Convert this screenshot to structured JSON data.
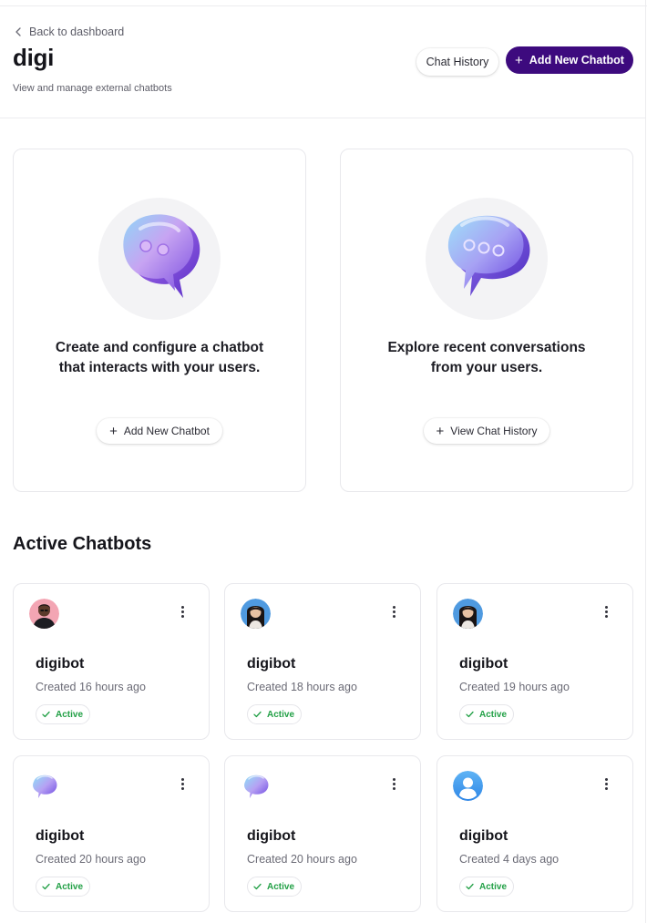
{
  "header": {
    "back_label": "Back to dashboard",
    "title": "digi",
    "subtitle": "View and manage external chatbots",
    "chat_history_label": "Chat History",
    "add_chatbot_label": "Add New Chatbot"
  },
  "features": [
    {
      "text": "Create and configure a chatbot that interacts with your users.",
      "button_label": "Add New Chatbot",
      "button_icon": "plus-icon",
      "illustration": "chat-bubble-two-dots"
    },
    {
      "text": "Explore recent conversations from your users.",
      "button_label": "View Chat History",
      "button_icon": "plus-icon",
      "illustration": "chat-bubble-three-dots"
    }
  ],
  "active_section": {
    "title": "Active Chatbots"
  },
  "bots": [
    {
      "name": "digibot",
      "created": "Created 16 hours ago",
      "status": "Active",
      "avatar": "man-portrait-pink-bg"
    },
    {
      "name": "digibot",
      "created": "Created 18 hours ago",
      "status": "Active",
      "avatar": "woman-portrait-blue-bg"
    },
    {
      "name": "digibot",
      "created": "Created 19 hours ago",
      "status": "Active",
      "avatar": "woman-portrait-blue-bg"
    },
    {
      "name": "digibot",
      "created": "Created 20 hours ago",
      "status": "Active",
      "avatar": "chat-bubble-icon"
    },
    {
      "name": "digibot",
      "created": "Created 20 hours ago",
      "status": "Active",
      "avatar": "chat-bubble-icon"
    },
    {
      "name": "digibot",
      "created": "Created 4 days ago",
      "status": "Active",
      "avatar": "default-user-icon"
    }
  ],
  "colors": {
    "primary": "#3d0a7e",
    "active_green": "#22a046",
    "border": "#e8e8ec"
  }
}
